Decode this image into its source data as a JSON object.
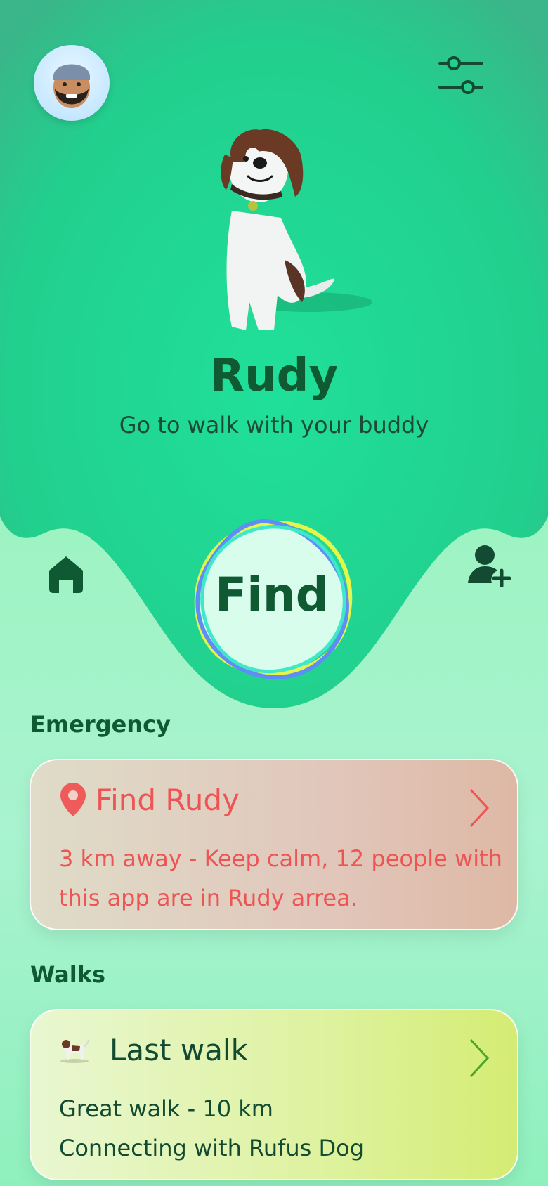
{
  "pet": {
    "name": "Rudy",
    "subtitle": "Go to walk with your buddy"
  },
  "find_button": {
    "label": "Find"
  },
  "emergency": {
    "section_title": "Emergency",
    "card_title": "Find Rudy",
    "card_body": "3 km away - Keep calm, 12 people with this app are in Rudy arrea."
  },
  "walks": {
    "section_title": "Walks",
    "card_title": "Last walk",
    "line1": "Great walk - 10 km",
    "line2": "Connecting with Rufus Dog"
  },
  "colors": {
    "accent_green": "#22d48f",
    "text_dark_green": "#0f5a32",
    "alert_red": "#ee5454"
  },
  "icons": [
    "user-avatar",
    "filter-sliders-icon",
    "home-icon",
    "add-user-icon",
    "location-pin-icon",
    "dog-icon",
    "chevron-right-icon"
  ]
}
